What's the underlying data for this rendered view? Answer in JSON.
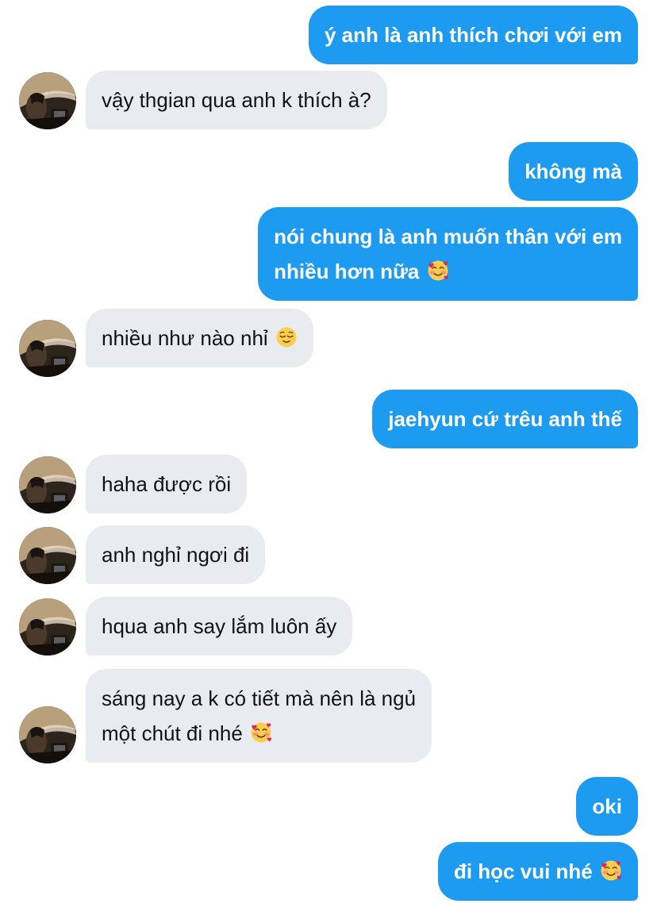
{
  "messages": [
    {
      "from": "me",
      "text": "ý anh là anh thích chơi với em"
    },
    {
      "from": "them",
      "text": "vậy thgian qua anh k thích à?"
    },
    {
      "from": "me",
      "text": "không mà"
    },
    {
      "from": "me",
      "lines": [
        "nói chung là anh muốn thân với em",
        "nhiều hơn nữa"
      ],
      "emoji": "smiling-face-with-hearts"
    },
    {
      "from": "them",
      "text": "nhiều như nào nhỉ",
      "emoji": "relieved-face"
    },
    {
      "from": "me",
      "text": "jaehyun cứ trêu anh thế"
    },
    {
      "from": "them",
      "text": "haha được rồi"
    },
    {
      "from": "them",
      "text": "anh nghỉ ngơi đi"
    },
    {
      "from": "them",
      "text": "hqua anh say lắm luôn ấy"
    },
    {
      "from": "them",
      "lines": [
        "sáng nay a k có tiết mà nên là ngủ",
        "một chút đi nhé"
      ],
      "emoji": "smiling-face-with-hearts"
    },
    {
      "from": "me",
      "text": "oki"
    },
    {
      "from": "me",
      "text": "đi học vui nhé",
      "emoji": "smiling-face-with-hearts"
    }
  ],
  "colors": {
    "outgoing_bubble": "#1d9bf0",
    "incoming_bubble": "#e8ecf0",
    "outgoing_text": "#ffffff",
    "incoming_text": "#0f1419"
  }
}
